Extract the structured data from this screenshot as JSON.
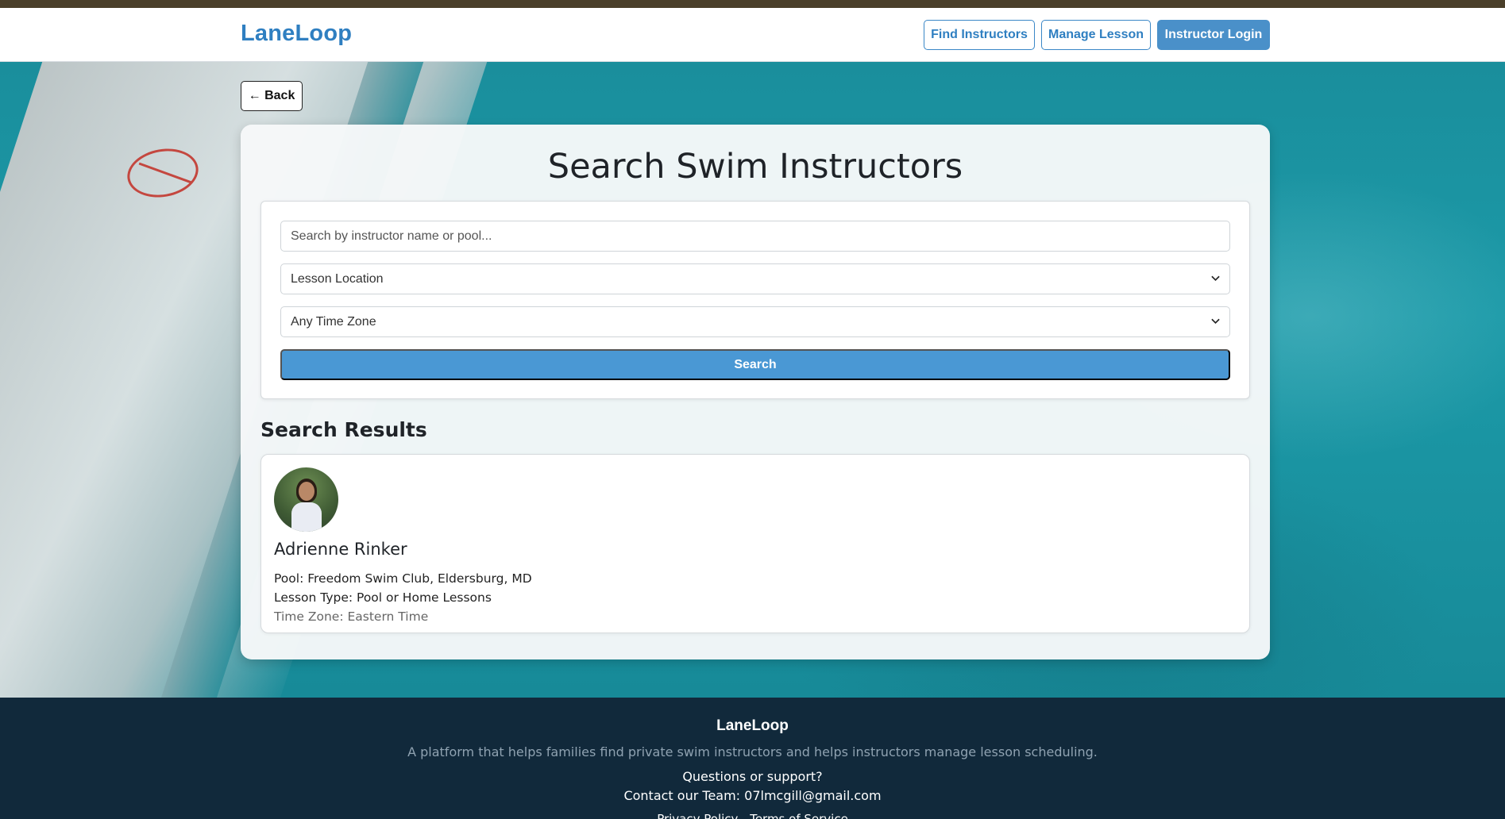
{
  "nav": {
    "brand": "LaneLoop",
    "find_label": "Find Instructors",
    "manage_label": "Manage Lesson",
    "login_label": "Instructor Login"
  },
  "back_label": "← Back",
  "search": {
    "title": "Search Swim Instructors",
    "placeholder": "Search by instructor name or pool...",
    "location_selected": "Lesson Location",
    "timezone_selected": "Any Time Zone",
    "button_label": "Search"
  },
  "results": {
    "heading": "Search Results",
    "items": [
      {
        "name": "Adrienne Rinker",
        "pool": "Pool: Freedom Swim Club, Eldersburg, MD",
        "lesson_type": "Lesson Type: Pool or Home Lessons",
        "time_zone": "Time Zone: Eastern Time"
      }
    ]
  },
  "footer": {
    "brand": "LaneLoop",
    "description": "A platform that helps families find private swim instructors and helps instructors manage lesson scheduling.",
    "question": "Questions or support?",
    "contact": "Contact our Team: 07lmcgill@gmail.com",
    "privacy": "Privacy Policy",
    "terms": "Terms of Service"
  },
  "colors": {
    "brand": "#2f7fc1",
    "primary_button": "#4a98d4",
    "footer_bg": "#11293b"
  }
}
